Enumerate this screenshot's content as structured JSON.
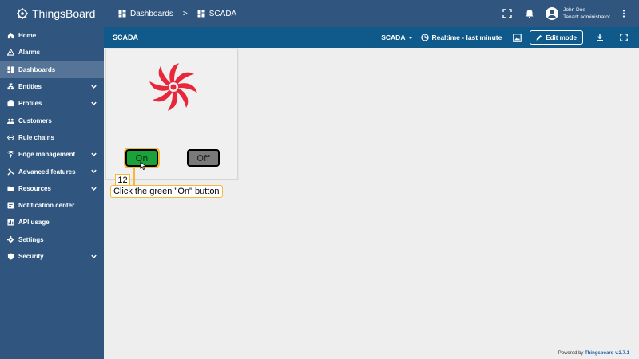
{
  "app": {
    "logo_text": "ThingsBoard"
  },
  "sidebar": {
    "items": [
      {
        "label": "Home",
        "icon": "home-icon"
      },
      {
        "label": "Alarms",
        "icon": "warning-icon"
      },
      {
        "label": "Dashboards",
        "icon": "dashboard-icon",
        "active": true
      },
      {
        "label": "Entities",
        "icon": "entities-icon",
        "expandable": true
      },
      {
        "label": "Profiles",
        "icon": "profiles-icon",
        "expandable": true
      },
      {
        "label": "Customers",
        "icon": "customers-icon"
      },
      {
        "label": "Rule chains",
        "icon": "rule-chains-icon"
      },
      {
        "label": "Edge management",
        "icon": "edge-icon",
        "expandable": true
      },
      {
        "label": "Advanced features",
        "icon": "tools-icon",
        "expandable": true
      },
      {
        "label": "Resources",
        "icon": "folder-icon",
        "expandable": true
      },
      {
        "label": "Notification center",
        "icon": "notification-icon"
      },
      {
        "label": "API usage",
        "icon": "chart-icon"
      },
      {
        "label": "Settings",
        "icon": "gear-icon"
      },
      {
        "label": "Security",
        "icon": "shield-icon",
        "expandable": true
      }
    ]
  },
  "topbar": {
    "breadcrumb": [
      "Dashboards",
      "SCADA"
    ],
    "separator": ">",
    "user_name": "John Doe",
    "user_role": "Tenant administrator"
  },
  "dashboard": {
    "title": "SCADA",
    "state_select": "SCADA",
    "timewindow": "Realtime - last minute",
    "edit_label": "Edit mode"
  },
  "widget": {
    "on_label": "On",
    "off_label": "Off"
  },
  "annotation": {
    "number": "12",
    "text": "Click the green \"On\" button"
  },
  "footer": {
    "prefix": "Powered by",
    "brand": "Thingsboard v.3.7.1"
  },
  "colors": {
    "sidebar": "#305680",
    "dash_toolbar": "#0f5a8a",
    "fan_red": "#e8273a",
    "on_green": "#1aa13a",
    "off_gray": "#7a7a7a",
    "highlight": "#f5b83b"
  }
}
